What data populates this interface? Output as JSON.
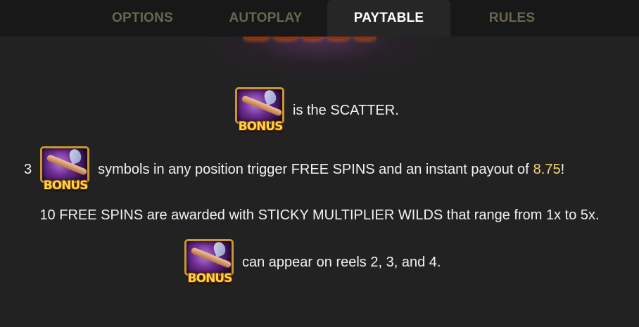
{
  "tabs": [
    {
      "label": "OPTIONS",
      "active": false
    },
    {
      "label": "AUTOPLAY",
      "active": false
    },
    {
      "label": "PAYTABLE",
      "active": true
    },
    {
      "label": "RULES",
      "active": false
    }
  ],
  "symbol": {
    "icon": "bonus-flute-icon",
    "label": "BONUS"
  },
  "content": {
    "scatter_text": "is the SCATTER.",
    "trigger_count": "3",
    "trigger_text": "symbols in any position trigger FREE SPINS and an instant payout of",
    "payout_value": "8.75",
    "payout_suffix": "!",
    "free_spins_text": "10 FREE SPINS are awarded with STICKY MULTIPLIER WILDS that range from 1x to 5x.",
    "reels_text": "can appear on reels 2, 3, and 4."
  },
  "colors": {
    "highlight": "#f5d77a",
    "tab_inactive": "#6b6650",
    "tab_active_bg": "#262626",
    "background": "#222222"
  }
}
